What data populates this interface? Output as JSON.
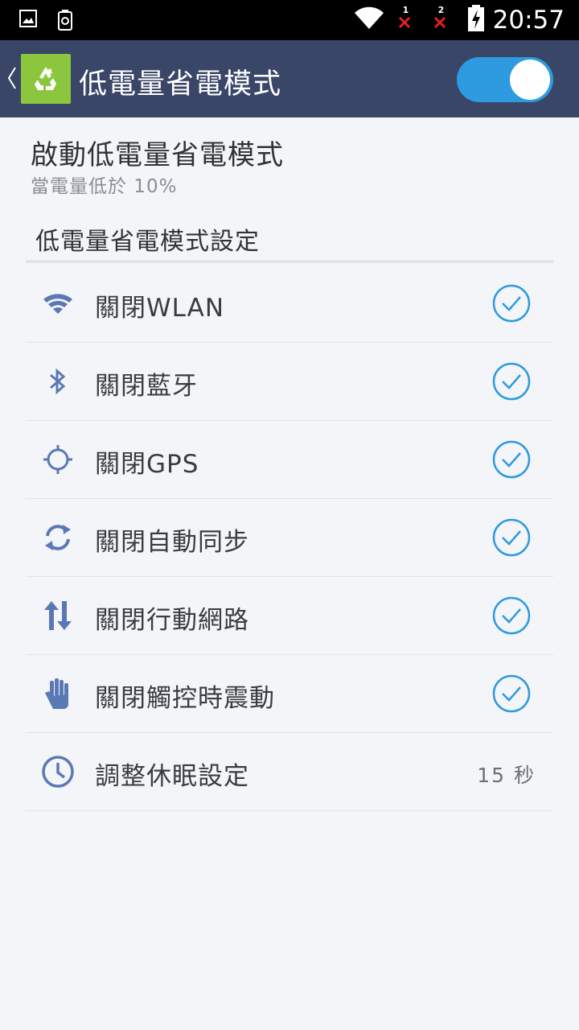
{
  "status_bar": {
    "time": "20:57",
    "sim1_label": "1",
    "sim2_label": "2"
  },
  "header": {
    "title": "低電量省電模式",
    "toggle_on": true,
    "accent": "#2e9ae0",
    "bar_color": "#3a4667",
    "icon_color": "#8cc63e"
  },
  "enable": {
    "title": "啟動低電量省電模式",
    "subtitle": "當電量低於 10%"
  },
  "settings": {
    "section_title": "低電量省電模式設定",
    "items": [
      {
        "label": "關閉WLAN",
        "icon": "wifi-icon",
        "checked": true
      },
      {
        "label": "關閉藍牙",
        "icon": "bluetooth-icon",
        "checked": true
      },
      {
        "label": "關閉GPS",
        "icon": "gps-icon",
        "checked": true
      },
      {
        "label": "關閉自動同步",
        "icon": "sync-icon",
        "checked": true
      },
      {
        "label": "關閉行動網路",
        "icon": "mobile-data-icon",
        "checked": true
      },
      {
        "label": "關閉觸控時震動",
        "icon": "hand-icon",
        "checked": true
      },
      {
        "label": "調整休眠設定",
        "icon": "clock-icon",
        "value": "15 秒"
      }
    ]
  }
}
